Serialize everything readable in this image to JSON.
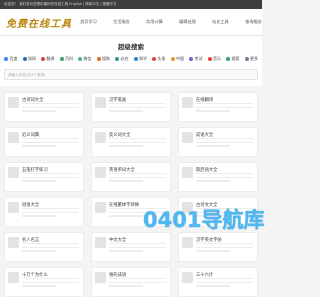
{
  "topbar": {
    "text": "欢迎您！ 我们将为您提供最好的在线工具 English | 简体中文 | 繁體中文"
  },
  "header": {
    "logo": "免费在线工具",
    "nav": [
      "首页学习",
      "生活服务",
      "实用计算",
      "编辑处理",
      "站长工具",
      "查询服务"
    ]
  },
  "search": {
    "title": "超级搜索",
    "placeholder": "请输入内容(共4个选项)",
    "categories": [
      {
        "label": "百度",
        "color": "#3385ff"
      },
      {
        "label": "知网",
        "color": "#2b6cb0"
      },
      {
        "label": "翻译",
        "color": "#e53e3e"
      },
      {
        "label": "百科",
        "color": "#38a169"
      },
      {
        "label": "微信",
        "color": "#48bb78"
      },
      {
        "label": "搜狗",
        "color": "#dd6b20"
      },
      {
        "label": "必应",
        "color": "#319795"
      },
      {
        "label": "知乎",
        "color": "#3182ce"
      },
      {
        "label": "头条",
        "color": "#e53e3e"
      },
      {
        "label": "中国",
        "color": "#d69e2e"
      },
      {
        "label": "考试",
        "color": "#805ad5"
      },
      {
        "label": "音乐",
        "color": "#e53e3e"
      },
      {
        "label": "搜索",
        "color": "#38a169"
      },
      {
        "label": "更多",
        "color": "#718096"
      }
    ]
  },
  "cards": [
    {
      "title": "古诗词大全"
    },
    {
      "title": "汉字笔画"
    },
    {
      "title": "在线翻译"
    },
    {
      "title": "近义词典"
    },
    {
      "title": "反义词大全"
    },
    {
      "title": "成语大全"
    },
    {
      "title": "五笔打字练习"
    },
    {
      "title": "英语单词大全"
    },
    {
      "title": "歇后语大全"
    },
    {
      "title": "谜语大全"
    },
    {
      "title": "在线繁体字转换"
    },
    {
      "title": "古诗文大全"
    },
    {
      "title": "名人名言"
    },
    {
      "title": "中文大全"
    },
    {
      "title": "汉字英文字帖"
    },
    {
      "title": "十万个为什么"
    },
    {
      "title": "谁的成语"
    },
    {
      "title": "三十六计"
    }
  ],
  "watermark": {
    "text": "0401导航库"
  }
}
